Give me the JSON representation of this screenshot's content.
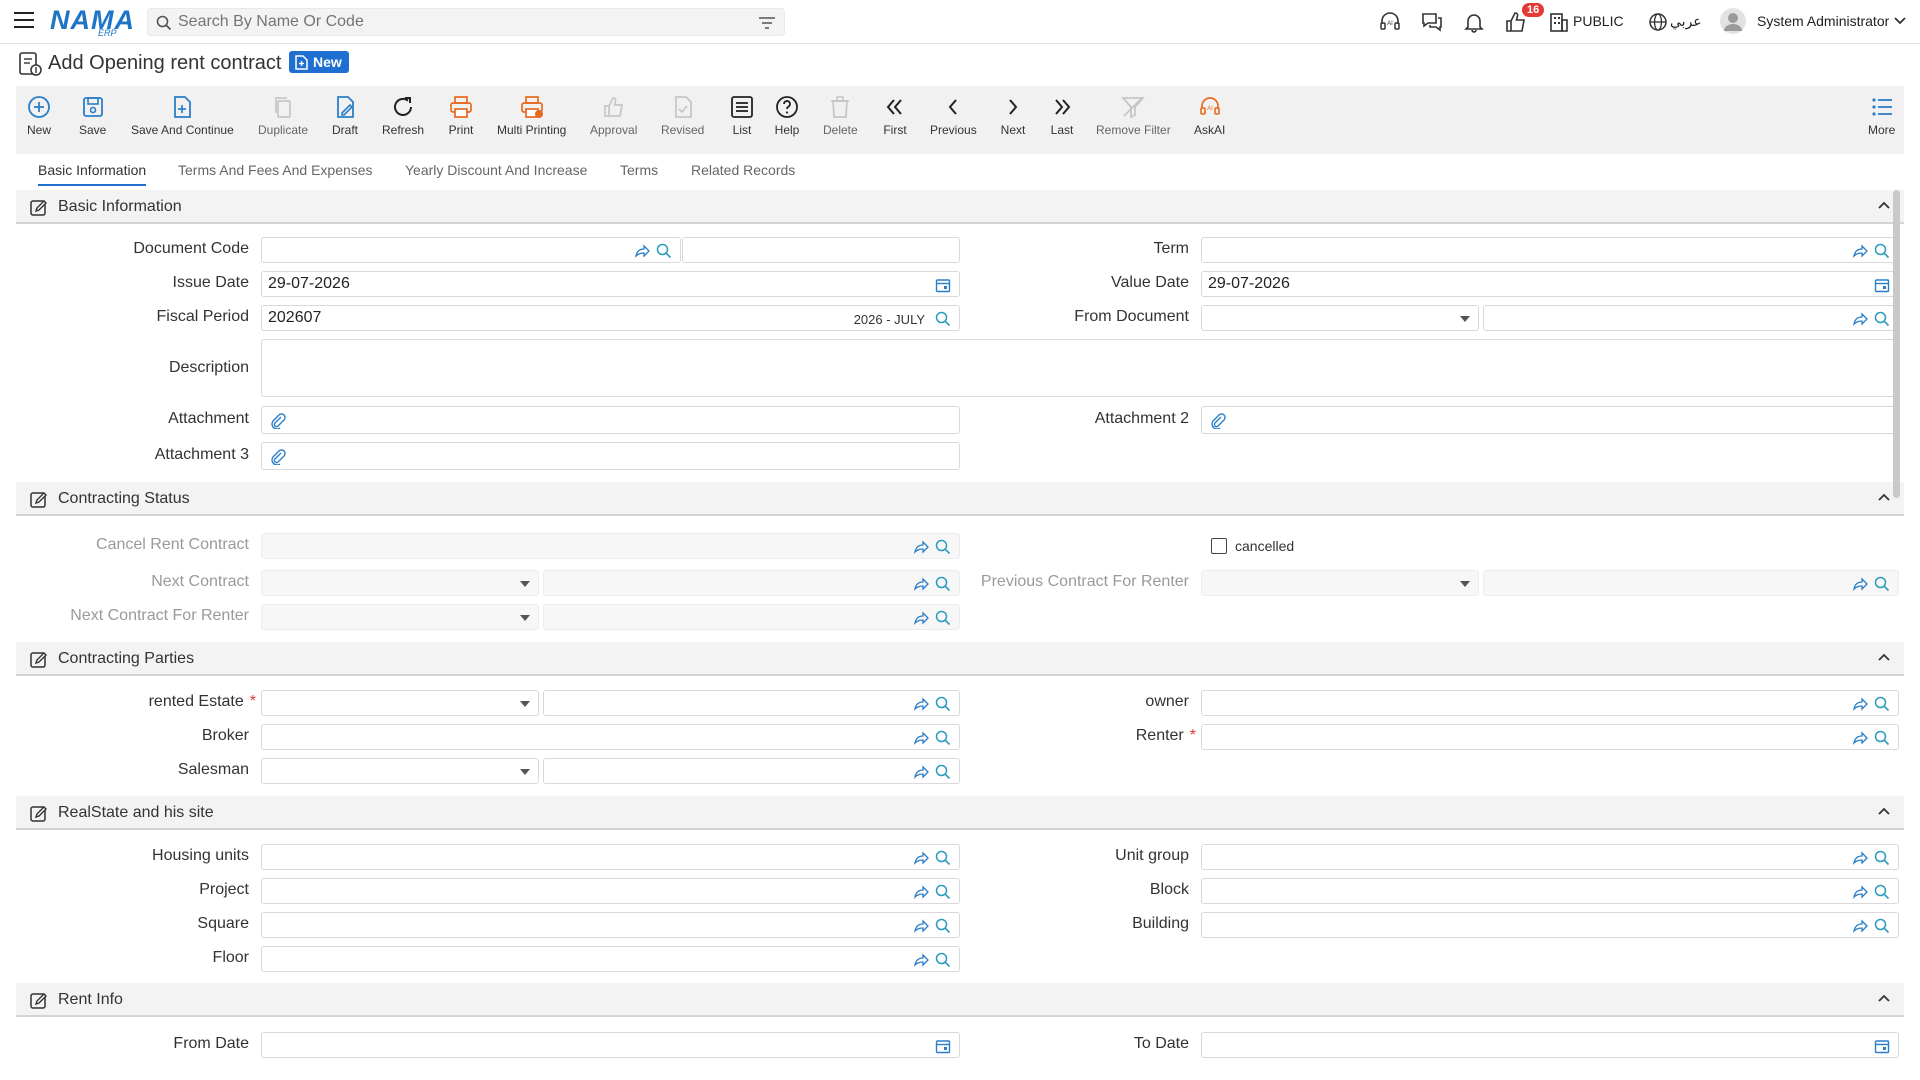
{
  "header": {
    "logo_text": "NAMA",
    "logo_sub": "ERP",
    "search_placeholder": "Search By Name Or Code",
    "notification_count": "16",
    "branch": "PUBLIC",
    "language": "عربي",
    "user": "System Administrator"
  },
  "page": {
    "title": "Add Opening rent contract",
    "status_badge": "New"
  },
  "toolbar": {
    "new": "New",
    "save": "Save",
    "save_continue": "Save And Continue",
    "duplicate": "Duplicate",
    "draft": "Draft",
    "refresh": "Refresh",
    "print": "Print",
    "multi_printing": "Multi Printing",
    "approval": "Approval",
    "revised": "Revised",
    "list": "List",
    "help": "Help",
    "delete": "Delete",
    "first": "First",
    "previous": "Previous",
    "next": "Next",
    "last": "Last",
    "remove_filter": "Remove Filter",
    "askai": "AskAI",
    "more": "More"
  },
  "tabs": [
    "Basic Information",
    "Terms And Fees And Expenses",
    "Yearly Discount And Increase",
    "Terms",
    "Related Records"
  ],
  "sections": {
    "basic": "Basic Information",
    "status": "Contracting Status",
    "parties": "Contracting Parties",
    "realstate": "RealState and his site",
    "rent": "Rent Info"
  },
  "basic": {
    "document_code_label": "Document Code",
    "term_label": "Term",
    "issue_date_label": "Issue Date",
    "issue_date_value": "29-07-2026",
    "value_date_label": "Value Date",
    "value_date_value": "29-07-2026",
    "fiscal_period_label": "Fiscal Period",
    "fiscal_period_value": "202607",
    "fiscal_period_name": "2026 - JULY",
    "from_document_label": "From Document",
    "description_label": "Description",
    "attachment_label": "Attachment",
    "attachment2_label": "Attachment 2",
    "attachment3_label": "Attachment 3"
  },
  "status": {
    "cancel_rent_contract_label": "Cancel Rent Contract",
    "cancelled_label": "cancelled",
    "next_contract_label": "Next Contract",
    "previous_contract_for_renter_label": "Previous Contract For Renter",
    "next_contract_for_renter_label": "Next Contract For Renter"
  },
  "parties": {
    "rented_estate_label": "rented Estate",
    "owner_label": "owner",
    "broker_label": "Broker",
    "renter_label": "Renter",
    "salesman_label": "Salesman",
    "required_mark": "*"
  },
  "realstate": {
    "housing_units_label": "Housing units",
    "unit_group_label": "Unit group",
    "project_label": "Project",
    "block_label": "Block",
    "square_label": "Square",
    "building_label": "Building",
    "floor_label": "Floor"
  },
  "rent": {
    "from_date_label": "From Date",
    "to_date_label": "To Date"
  },
  "colors": {
    "brand_blue": "#1f75c5",
    "accent_blue": "#1f6fd0",
    "icon_teal": "#2a9bbf",
    "print_orange": "#e86a1e",
    "badge_red": "#e53935"
  }
}
